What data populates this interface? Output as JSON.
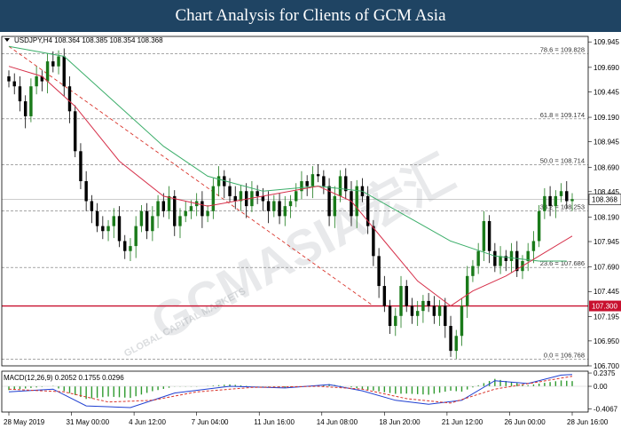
{
  "banner": {
    "title": "Chart Analysis for Clients of GCM Asia"
  },
  "watermark": {
    "brand": "GCMASIA宏汇",
    "sub": "GLOBAL CAPITAL MARKETS"
  },
  "colors": {
    "banner_bg": "#1f4463",
    "bull": "#1a7a1a",
    "bear": "#000000",
    "ma_fast": "#d6304a",
    "ma_slow": "#3cae6a",
    "support": "#c8102e",
    "trendline": "#d9342b",
    "macd_line": "#1f3fd1",
    "signal_line": "#d9342b",
    "hist": "#2f9a2f"
  },
  "chart_data": [
    {
      "type": "candlestick",
      "header": "USDJPY,H4  108.364 108.385 108.354 108.368",
      "ylim": [
        106.7,
        110.0
      ],
      "yticks": [
        "109.945",
        "109.690",
        "109.445",
        "109.190",
        "108.945",
        "108.690",
        "108.445",
        "108.190",
        "107.945",
        "107.690",
        "107.445",
        "107.195",
        "106.950",
        "106.700"
      ],
      "xticks": [
        "28 May 2019",
        "31 May 00:00",
        "4 Jun 12:00",
        "7 Jun 04:00",
        "11 Jun 16:00",
        "14 Jun 08:00",
        "18 Jun 20:00",
        "21 Jun 12:00",
        "26 Jun 00:00",
        "28 Jun 16:00"
      ],
      "current_price": "108.368",
      "support_label": "107.300",
      "fib_levels": [
        {
          "label": "78.6 = 109.828",
          "value": 109.828
        },
        {
          "label": "61.8 = 109.174",
          "value": 109.174
        },
        {
          "label": "50.0 = 108.714",
          "value": 108.714
        },
        {
          "label": "38.2 = 108.253",
          "value": 108.253
        },
        {
          "label": "23.6 = 107.686",
          "value": 107.686
        },
        {
          "label": "0.0 = 106.768",
          "value": 106.768
        }
      ],
      "support_level": 107.3,
      "current_price_value": 108.368,
      "trendline": [
        [
          0,
          109.9
        ],
        [
          66,
          107.3
        ]
      ],
      "closes": [
        109.55,
        109.5,
        109.35,
        109.2,
        109.5,
        109.6,
        109.55,
        109.75,
        109.7,
        109.8,
        109.5,
        109.25,
        108.85,
        108.55,
        108.35,
        108.25,
        108.1,
        108.05,
        108.1,
        108.2,
        107.95,
        107.85,
        107.9,
        108.1,
        108.25,
        108.05,
        108.2,
        108.35,
        108.25,
        108.4,
        108.1,
        108.2,
        108.25,
        108.3,
        108.35,
        108.2,
        108.25,
        108.5,
        108.6,
        108.5,
        108.4,
        108.35,
        108.45,
        108.3,
        108.45,
        108.4,
        108.35,
        108.25,
        108.35,
        108.2,
        108.3,
        108.35,
        108.45,
        108.55,
        108.5,
        108.62,
        108.6,
        108.5,
        108.2,
        108.4,
        108.6,
        108.45,
        108.2,
        108.5,
        108.4,
        108.1,
        107.8,
        107.5,
        107.3,
        107.1,
        107.2,
        107.5,
        107.3,
        107.2,
        107.25,
        107.35,
        107.3,
        107.2,
        107.3,
        107.1,
        106.85,
        107.0,
        107.3,
        107.6,
        107.7,
        107.85,
        108.15,
        107.85,
        107.7,
        107.8,
        107.75,
        107.85,
        107.65,
        107.75,
        107.85,
        107.95,
        108.25,
        108.4,
        108.3,
        108.4,
        108.45,
        108.35,
        108.37
      ],
      "ma_fast": [
        [
          0,
          109.7
        ],
        [
          6,
          109.6
        ],
        [
          12,
          109.3
        ],
        [
          20,
          108.75
        ],
        [
          28,
          108.4
        ],
        [
          36,
          108.3
        ],
        [
          46,
          108.4
        ],
        [
          56,
          108.5
        ],
        [
          62,
          108.35
        ],
        [
          68,
          107.95
        ],
        [
          74,
          107.55
        ],
        [
          80,
          107.3
        ],
        [
          84,
          107.45
        ],
        [
          90,
          107.6
        ],
        [
          96,
          107.8
        ],
        [
          102,
          108.0
        ]
      ],
      "ma_slow": [
        [
          0,
          109.9
        ],
        [
          10,
          109.8
        ],
        [
          18,
          109.4
        ],
        [
          28,
          108.9
        ],
        [
          36,
          108.6
        ],
        [
          46,
          108.45
        ],
        [
          56,
          108.5
        ],
        [
          64,
          108.45
        ],
        [
          72,
          108.2
        ],
        [
          80,
          107.95
        ],
        [
          88,
          107.8
        ],
        [
          96,
          107.75
        ],
        [
          101,
          107.75
        ]
      ]
    },
    {
      "type": "macd",
      "label": "MACD(12,26,9) 0.2052 0.1755 0.0296",
      "ylim": [
        -0.46,
        0.27
      ],
      "yticks": [
        "0.2375",
        "0.00",
        "-0.4067"
      ],
      "macd": [
        [
          0,
          -0.1
        ],
        [
          8,
          -0.05
        ],
        [
          14,
          -0.35
        ],
        [
          22,
          -0.38
        ],
        [
          30,
          -0.12
        ],
        [
          40,
          0.0
        ],
        [
          50,
          -0.03
        ],
        [
          58,
          0.03
        ],
        [
          64,
          -0.08
        ],
        [
          70,
          -0.25
        ],
        [
          76,
          -0.32
        ],
        [
          82,
          -0.25
        ],
        [
          88,
          0.1
        ],
        [
          94,
          0.05
        ],
        [
          100,
          0.2
        ],
        [
          102,
          0.21
        ]
      ],
      "signal": [
        [
          0,
          -0.05
        ],
        [
          10,
          -0.1
        ],
        [
          18,
          -0.28
        ],
        [
          26,
          -0.25
        ],
        [
          34,
          -0.1
        ],
        [
          44,
          -0.02
        ],
        [
          56,
          0.0
        ],
        [
          64,
          -0.05
        ],
        [
          72,
          -0.22
        ],
        [
          80,
          -0.3
        ],
        [
          88,
          -0.05
        ],
        [
          96,
          0.08
        ],
        [
          102,
          0.18
        ]
      ]
    }
  ]
}
